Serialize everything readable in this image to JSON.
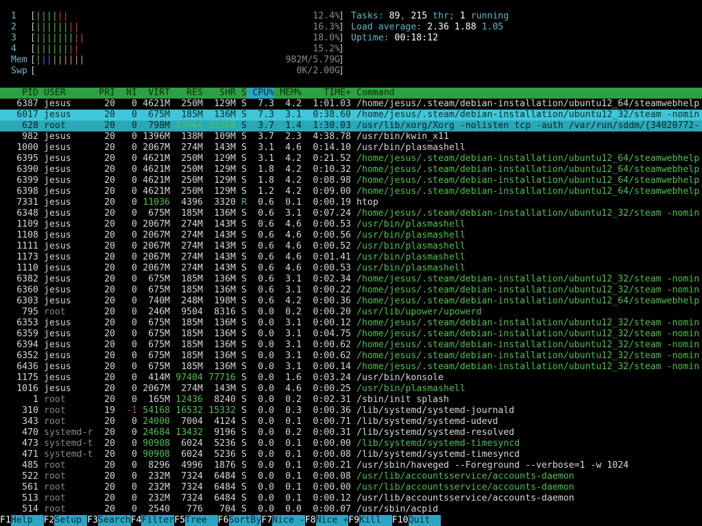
{
  "meters": {
    "cpu": [
      {
        "label": "1",
        "value": "12.4%",
        "level": 0.124
      },
      {
        "label": "2",
        "value": "16.3%",
        "level": 0.163
      },
      {
        "label": "3",
        "value": "18.0%",
        "level": 0.18
      },
      {
        "label": "4",
        "value": "15.2%",
        "level": 0.152
      }
    ],
    "mem": {
      "label": "Mem",
      "value": "982M/5.79G",
      "level": 0.17
    },
    "swp": {
      "label": "Swp",
      "value": "0K/2.00G",
      "level": 0
    }
  },
  "summary": {
    "tasks_label": "Tasks: ",
    "tasks": "89",
    "thr_sep": ", ",
    "threads": "215",
    "thr_label": " thr; ",
    "running": "1",
    "running_label": " running",
    "load_label": "Load average: ",
    "load1": "2.36",
    "load5": "1.88",
    "load15": "1.05",
    "uptime_label": "Uptime: ",
    "uptime": "00:18:12"
  },
  "header": {
    "pid": "PID",
    "user": "USER",
    "pri": "PRI",
    "ni": "NI",
    "virt": "VIRT",
    "res": "RES",
    "shr": "SHR",
    "s": "S",
    "cpu": "CPU%",
    "mem": "MEM%",
    "time": "TIME+",
    "cmd": "Command"
  },
  "rows": [
    {
      "pid": "6387",
      "user": "jesus",
      "pri": "20",
      "ni": "0",
      "virt": "4621M",
      "res": "250M",
      "shr": "129M",
      "s": "S",
      "cpu": "7.3",
      "mem": "4.2",
      "time": "1:01.03",
      "cmd": "/home/jesus/.steam/debian-installation/ubuntu12_64/steamwebhelp",
      "thread": false,
      "sel": "none"
    },
    {
      "pid": "6017",
      "user": "jesus",
      "pri": "20",
      "ni": "0",
      "virt": "675M",
      "res": "185M",
      "shr": "136M",
      "s": "S",
      "cpu": "7.3",
      "mem": "3.1",
      "time": "0:38.60",
      "cmd": "/home/jesus/.steam/debian-installation/ubuntu12_32/steam -nomin",
      "thread": false,
      "sel": "selected"
    },
    {
      "pid": "628",
      "user": "root",
      "pri": "20",
      "ni": "0",
      "virt": "798M",
      "res": "87064",
      "shr": "55388",
      "s": "S",
      "cpu": "3.7",
      "mem": "1.4",
      "time": "1:30.03",
      "cmd": "/usr/lib/xorg/Xorg -nolisten tcp -auth /var/run/sddm/{34020772-",
      "thread": false,
      "sel": "sel2"
    },
    {
      "pid": "982",
      "user": "jesus",
      "pri": "20",
      "ni": "0",
      "virt": "1396M",
      "res": "138M",
      "shr": "109M",
      "s": "S",
      "cpu": "3.7",
      "mem": "2.3",
      "time": "4:38.78",
      "cmd": "/usr/bin/kwin_x11",
      "thread": false,
      "sel": "none"
    },
    {
      "pid": "1000",
      "user": "jesus",
      "pri": "20",
      "ni": "0",
      "virt": "2067M",
      "res": "274M",
      "shr": "143M",
      "s": "S",
      "cpu": "3.1",
      "mem": "4.6",
      "time": "0:14.10",
      "cmd": "/usr/bin/plasmashell",
      "thread": false,
      "sel": "none"
    },
    {
      "pid": "6395",
      "user": "jesus",
      "pri": "20",
      "ni": "0",
      "virt": "4621M",
      "res": "250M",
      "shr": "129M",
      "s": "S",
      "cpu": "3.1",
      "mem": "4.2",
      "time": "0:21.52",
      "cmd": "/home/jesus/.steam/debian-installation/ubuntu12_64/steamwebhelp",
      "thread": true,
      "sel": "none"
    },
    {
      "pid": "6390",
      "user": "jesus",
      "pri": "20",
      "ni": "0",
      "virt": "4621M",
      "res": "250M",
      "shr": "129M",
      "s": "S",
      "cpu": "1.8",
      "mem": "4.2",
      "time": "0:10.32",
      "cmd": "/home/jesus/.steam/debian-installation/ubuntu12_64/steamwebhelp",
      "thread": true,
      "sel": "none"
    },
    {
      "pid": "6399",
      "user": "jesus",
      "pri": "20",
      "ni": "0",
      "virt": "4621M",
      "res": "250M",
      "shr": "129M",
      "s": "S",
      "cpu": "1.8",
      "mem": "4.2",
      "time": "0:08.98",
      "cmd": "/home/jesus/.steam/debian-installation/ubuntu12_64/steamwebhelp",
      "thread": true,
      "sel": "none"
    },
    {
      "pid": "6398",
      "user": "jesus",
      "pri": "20",
      "ni": "0",
      "virt": "4621M",
      "res": "250M",
      "shr": "129M",
      "s": "S",
      "cpu": "1.2",
      "mem": "4.2",
      "time": "0:09.00",
      "cmd": "/home/jesus/.steam/debian-installation/ubuntu12_64/steamwebhelp",
      "thread": true,
      "sel": "none"
    },
    {
      "pid": "7331",
      "user": "jesus",
      "pri": "20",
      "ni": "0",
      "virt": "11036",
      "res": "4396",
      "shr": "3320",
      "s": "R",
      "cpu": "0.6",
      "mem": "0.1",
      "time": "0:00.19",
      "cmd": "htop",
      "thread": false,
      "sel": "none"
    },
    {
      "pid": "6348",
      "user": "jesus",
      "pri": "20",
      "ni": "0",
      "virt": "675M",
      "res": "185M",
      "shr": "136M",
      "s": "S",
      "cpu": "0.6",
      "mem": "3.1",
      "time": "0:07.24",
      "cmd": "/home/jesus/.steam/debian-installation/ubuntu12_32/steam -nomin",
      "thread": true,
      "sel": "none"
    },
    {
      "pid": "1109",
      "user": "jesus",
      "pri": "20",
      "ni": "0",
      "virt": "2067M",
      "res": "274M",
      "shr": "143M",
      "s": "S",
      "cpu": "0.6",
      "mem": "4.6",
      "time": "0:00.53",
      "cmd": "/usr/bin/plasmashell",
      "thread": true,
      "sel": "none"
    },
    {
      "pid": "1108",
      "user": "jesus",
      "pri": "20",
      "ni": "0",
      "virt": "2067M",
      "res": "274M",
      "shr": "143M",
      "s": "S",
      "cpu": "0.6",
      "mem": "4.6",
      "time": "0:00.56",
      "cmd": "/usr/bin/plasmashell",
      "thread": true,
      "sel": "none"
    },
    {
      "pid": "1111",
      "user": "jesus",
      "pri": "20",
      "ni": "0",
      "virt": "2067M",
      "res": "274M",
      "shr": "143M",
      "s": "S",
      "cpu": "0.6",
      "mem": "4.6",
      "time": "0:00.52",
      "cmd": "/usr/bin/plasmashell",
      "thread": true,
      "sel": "none"
    },
    {
      "pid": "1173",
      "user": "jesus",
      "pri": "20",
      "ni": "0",
      "virt": "2067M",
      "res": "274M",
      "shr": "143M",
      "s": "S",
      "cpu": "0.6",
      "mem": "4.6",
      "time": "0:01.41",
      "cmd": "/usr/bin/plasmashell",
      "thread": true,
      "sel": "none"
    },
    {
      "pid": "1110",
      "user": "jesus",
      "pri": "20",
      "ni": "0",
      "virt": "2067M",
      "res": "274M",
      "shr": "143M",
      "s": "S",
      "cpu": "0.6",
      "mem": "4.6",
      "time": "0:00.53",
      "cmd": "/usr/bin/plasmashell",
      "thread": true,
      "sel": "none"
    },
    {
      "pid": "6382",
      "user": "jesus",
      "pri": "20",
      "ni": "0",
      "virt": "675M",
      "res": "185M",
      "shr": "136M",
      "s": "S",
      "cpu": "0.6",
      "mem": "3.1",
      "time": "0:02.34",
      "cmd": "/home/jesus/.steam/debian-installation/ubuntu12_32/steam -nomin",
      "thread": true,
      "sel": "none"
    },
    {
      "pid": "6360",
      "user": "jesus",
      "pri": "20",
      "ni": "0",
      "virt": "675M",
      "res": "185M",
      "shr": "136M",
      "s": "S",
      "cpu": "0.6",
      "mem": "3.1",
      "time": "0:00.22",
      "cmd": "/home/jesus/.steam/debian-installation/ubuntu12_32/steam -nomin",
      "thread": true,
      "sel": "none"
    },
    {
      "pid": "6303",
      "user": "jesus",
      "pri": "20",
      "ni": "0",
      "virt": "740M",
      "res": "248M",
      "shr": "198M",
      "s": "S",
      "cpu": "0.6",
      "mem": "4.2",
      "time": "0:00.36",
      "cmd": "/home/jesus/.steam/debian-installation/ubuntu12_64/steamwebhelp",
      "thread": true,
      "sel": "none"
    },
    {
      "pid": "795",
      "user": "root",
      "pri": "20",
      "ni": "0",
      "virt": "246M",
      "res": "9504",
      "shr": "8316",
      "s": "S",
      "cpu": "0.0",
      "mem": "0.2",
      "time": "0:00.20",
      "cmd": "/usr/lib/upower/upowerd",
      "thread": true,
      "sel": "none"
    },
    {
      "pid": "6353",
      "user": "jesus",
      "pri": "20",
      "ni": "0",
      "virt": "675M",
      "res": "185M",
      "shr": "136M",
      "s": "S",
      "cpu": "0.0",
      "mem": "3.1",
      "time": "0:00.12",
      "cmd": "/home/jesus/.steam/debian-installation/ubuntu12_32/steam -nomin",
      "thread": true,
      "sel": "none"
    },
    {
      "pid": "6359",
      "user": "jesus",
      "pri": "20",
      "ni": "0",
      "virt": "675M",
      "res": "185M",
      "shr": "136M",
      "s": "S",
      "cpu": "0.0",
      "mem": "3.1",
      "time": "0:04.75",
      "cmd": "/home/jesus/.steam/debian-installation/ubuntu12_32/steam -nomin",
      "thread": true,
      "sel": "none"
    },
    {
      "pid": "6394",
      "user": "jesus",
      "pri": "20",
      "ni": "0",
      "virt": "675M",
      "res": "185M",
      "shr": "136M",
      "s": "S",
      "cpu": "0.0",
      "mem": "3.1",
      "time": "0:00.62",
      "cmd": "/home/jesus/.steam/debian-installation/ubuntu12_32/steam -nomin",
      "thread": true,
      "sel": "none"
    },
    {
      "pid": "6352",
      "user": "jesus",
      "pri": "20",
      "ni": "0",
      "virt": "675M",
      "res": "185M",
      "shr": "136M",
      "s": "S",
      "cpu": "0.0",
      "mem": "3.1",
      "time": "0:00.62",
      "cmd": "/home/jesus/.steam/debian-installation/ubuntu12_32/steam -nomin",
      "thread": true,
      "sel": "none"
    },
    {
      "pid": "6436",
      "user": "jesus",
      "pri": "20",
      "ni": "0",
      "virt": "675M",
      "res": "185M",
      "shr": "136M",
      "s": "S",
      "cpu": "0.0",
      "mem": "3.1",
      "time": "0:00.14",
      "cmd": "/home/jesus/.steam/debian-installation/ubuntu12_32/steam -nomin",
      "thread": true,
      "sel": "none"
    },
    {
      "pid": "1175",
      "user": "jesus",
      "pri": "20",
      "ni": "0",
      "virt": "414M",
      "res": "97404",
      "shr": "77716",
      "s": "S",
      "cpu": "0.0",
      "mem": "1.6",
      "time": "0:03.24",
      "cmd": "/usr/bin/konsole",
      "thread": false,
      "sel": "none"
    },
    {
      "pid": "1016",
      "user": "jesus",
      "pri": "20",
      "ni": "0",
      "virt": "2067M",
      "res": "274M",
      "shr": "143M",
      "s": "S",
      "cpu": "0.0",
      "mem": "4.6",
      "time": "0:00.25",
      "cmd": "/usr/bin/plasmashell",
      "thread": true,
      "sel": "none"
    },
    {
      "pid": "1",
      "user": "root",
      "pri": "20",
      "ni": "0",
      "virt": "165M",
      "res": "12436",
      "shr": "8240",
      "s": "S",
      "cpu": "0.0",
      "mem": "0.2",
      "time": "0:02.31",
      "cmd": "/sbin/init splash",
      "thread": false,
      "sel": "none"
    },
    {
      "pid": "310",
      "user": "root",
      "pri": "19",
      "ni": "-1",
      "virt": "54168",
      "res": "16532",
      "shr": "15332",
      "s": "S",
      "cpu": "0.0",
      "mem": "0.3",
      "time": "0:00.36",
      "cmd": "/lib/systemd/systemd-journald",
      "thread": false,
      "sel": "none"
    },
    {
      "pid": "343",
      "user": "root",
      "pri": "20",
      "ni": "0",
      "virt": "24000",
      "res": "7004",
      "shr": "4124",
      "s": "S",
      "cpu": "0.0",
      "mem": "0.1",
      "time": "0:00.71",
      "cmd": "/lib/systemd/systemd-udevd",
      "thread": false,
      "sel": "none"
    },
    {
      "pid": "470",
      "user": "systemd-r",
      "pri": "20",
      "ni": "0",
      "virt": "24684",
      "res": "13432",
      "shr": "9196",
      "s": "S",
      "cpu": "0.0",
      "mem": "0.2",
      "time": "0:00.31",
      "cmd": "/lib/systemd/systemd-resolved",
      "thread": false,
      "sel": "none"
    },
    {
      "pid": "473",
      "user": "systemd-t",
      "pri": "20",
      "ni": "0",
      "virt": "90908",
      "res": "6024",
      "shr": "5236",
      "s": "S",
      "cpu": "0.0",
      "mem": "0.1",
      "time": "0:00.00",
      "cmd": "/lib/systemd/systemd-timesyncd",
      "thread": true,
      "sel": "none"
    },
    {
      "pid": "471",
      "user": "systemd-t",
      "pri": "20",
      "ni": "0",
      "virt": "90908",
      "res": "6024",
      "shr": "5236",
      "s": "S",
      "cpu": "0.0",
      "mem": "0.1",
      "time": "0:00.08",
      "cmd": "/lib/systemd/systemd-timesyncd",
      "thread": false,
      "sel": "none"
    },
    {
      "pid": "485",
      "user": "root",
      "pri": "20",
      "ni": "0",
      "virt": "8296",
      "res": "4996",
      "shr": "1876",
      "s": "S",
      "cpu": "0.0",
      "mem": "0.1",
      "time": "0:00.21",
      "cmd": "/usr/sbin/haveged --Foreground --verbose=1 -w 1024",
      "thread": false,
      "sel": "none"
    },
    {
      "pid": "522",
      "user": "root",
      "pri": "20",
      "ni": "0",
      "virt": "232M",
      "res": "7324",
      "shr": "6484",
      "s": "S",
      "cpu": "0.0",
      "mem": "0.1",
      "time": "0:00.08",
      "cmd": "/usr/lib/accountsservice/accounts-daemon",
      "thread": true,
      "sel": "none"
    },
    {
      "pid": "561",
      "user": "root",
      "pri": "20",
      "ni": "0",
      "virt": "232M",
      "res": "7324",
      "shr": "6484",
      "s": "S",
      "cpu": "0.0",
      "mem": "0.1",
      "time": "0:00.00",
      "cmd": "/usr/lib/accountsservice/accounts-daemon",
      "thread": true,
      "sel": "none"
    },
    {
      "pid": "513",
      "user": "root",
      "pri": "20",
      "ni": "0",
      "virt": "232M",
      "res": "7324",
      "shr": "6484",
      "s": "S",
      "cpu": "0.0",
      "mem": "0.1",
      "time": "0:00.12",
      "cmd": "/usr/lib/accountsservice/accounts-daemon",
      "thread": false,
      "sel": "none"
    },
    {
      "pid": "514",
      "user": "root",
      "pri": "20",
      "ni": "0",
      "virt": "2540",
      "res": "776",
      "shr": "704",
      "s": "S",
      "cpu": "0.0",
      "mem": "0.0",
      "time": "0:00.07",
      "cmd": "/usr/sbin/acpid",
      "thread": false,
      "sel": "none"
    }
  ],
  "footer": [
    {
      "key": "F1",
      "label": "Help  "
    },
    {
      "key": "F2",
      "label": "Setup "
    },
    {
      "key": "F3",
      "label": "Search"
    },
    {
      "key": "F4",
      "label": "Filter"
    },
    {
      "key": "F5",
      "label": "Tree  "
    },
    {
      "key": "F6",
      "label": "SortBy"
    },
    {
      "key": "F7",
      "label": "Nice -"
    },
    {
      "key": "F8",
      "label": "Nice +"
    },
    {
      "key": "F9",
      "label": "Kill  "
    },
    {
      "key": "F10",
      "label": "Quit  "
    }
  ],
  "colors": {
    "header_bg": "#2ea043",
    "selected_bg": "#3ec6d8",
    "footer_label_bg": "#2aa6c4",
    "thread_cmd": "#4ec24e",
    "label": "#6fb7c9"
  }
}
